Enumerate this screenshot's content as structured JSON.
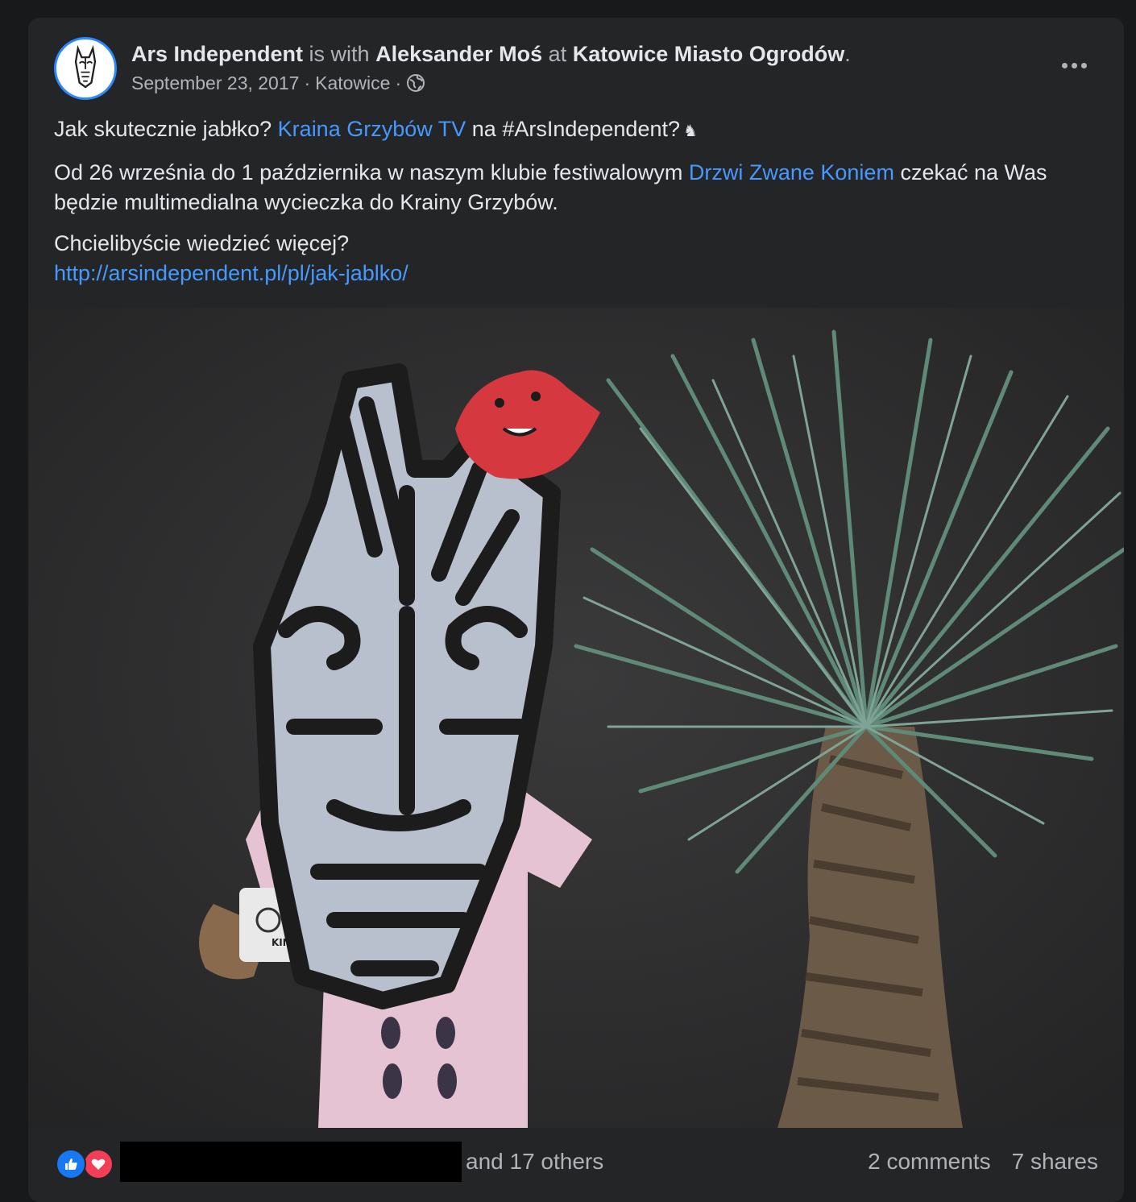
{
  "post": {
    "author": "Ars Independent",
    "with_word": "is with",
    "tagged": "Aleksander Moś",
    "at_word": "at",
    "place": "Katowice Miasto Ogrodów",
    "period": ".",
    "date": "September 23, 2017",
    "sep1": "·",
    "location": "Katowice",
    "sep2": "·",
    "icons": {
      "more": "more-options-icon",
      "privacy": "globe-icon"
    }
  },
  "content": {
    "line1_a": "Jak skutecznie jabłko?",
    "line1_link": "Kraina Grzybów TV",
    "line1_b": "na #ArsIndependent?",
    "line1_emoji": "♞",
    "para2_a": "Od 26 września do 1 października w naszym klubie festiwalowym",
    "para2_link": "Drzwi Zwane Koniem",
    "para2_b": "czekać na Was będzie multimedialna wycieczka do Krainy Grzybów.",
    "para3": "Chcielibyście wiedzieć więcej?",
    "url": "http://arsindependent.pl/pl/jak-jablko/"
  },
  "photo": {
    "mug_text": "KINDER T"
  },
  "footer": {
    "reactions": [
      "like-icon",
      "love-icon"
    ],
    "others": "and 17 others",
    "comments": "2 comments",
    "shares": "7 shares"
  },
  "colors": {
    "link": "#4599ff",
    "card": "#242526",
    "page": "#18191a",
    "muted": "#b0b3b8"
  }
}
